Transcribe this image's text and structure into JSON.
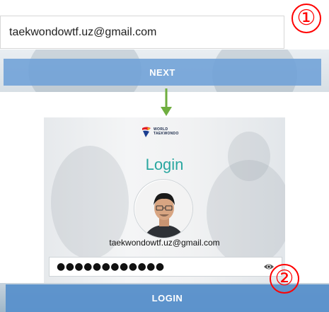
{
  "step1": {
    "email_value": "taekwondowtf.uz@gmail.com",
    "next_label": "NEXT",
    "badge": "①"
  },
  "step2": {
    "logo_text": [
      "WORLD",
      "TAEKWONDO"
    ],
    "title": "Login",
    "user_email": "taekwondowtf.uz@gmail.com",
    "password_masked": "●●●●●●●●●●●●",
    "login_label": "LOGIN",
    "badge": "②"
  },
  "icons": {
    "arrow": "arrow-down-icon",
    "eye": "eye-icon",
    "logo": "world-taekwondo-logo",
    "avatar": "user-avatar"
  },
  "colors": {
    "button_blue": "#5890cb",
    "next_blue": "#6ea0d7",
    "title_teal": "#2aa7a0",
    "arrow_green": "#6fae3f",
    "badge_red": "#ff0000"
  }
}
